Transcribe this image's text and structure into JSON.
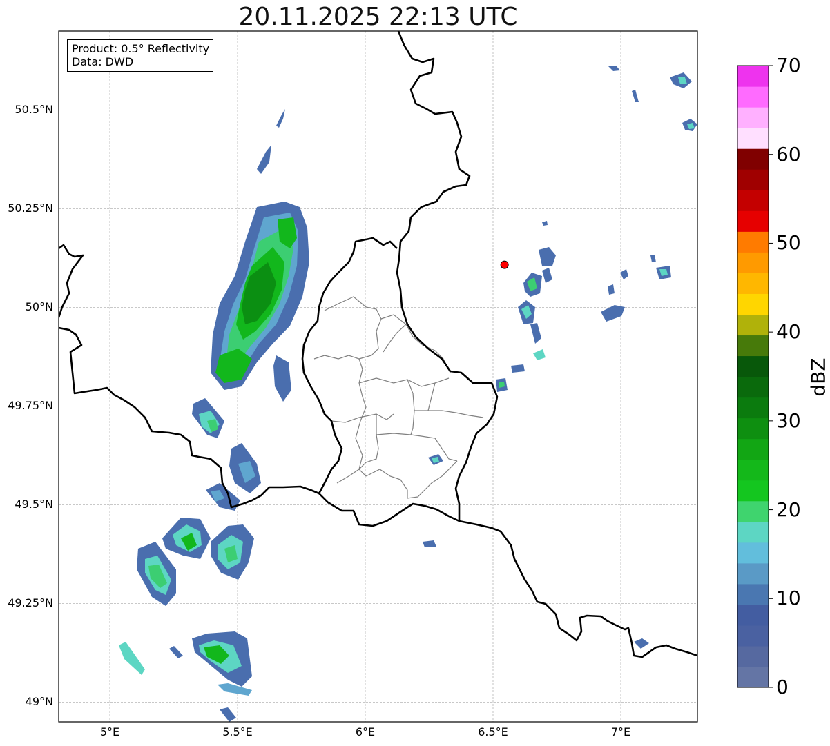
{
  "title": "20.11.2025 22:13 UTC",
  "info": {
    "product_line": "Product: 0.5° Reflectivity",
    "data_line": "Data: DWD"
  },
  "map": {
    "lon_range": [
      4.8,
      7.3
    ],
    "lat_range": [
      48.95,
      50.7
    ],
    "lat_ticks": [
      {
        "value": 49.0,
        "label": "49°N"
      },
      {
        "value": 49.25,
        "label": "49.25°N"
      },
      {
        "value": 49.5,
        "label": "49.5°N"
      },
      {
        "value": 49.75,
        "label": "49.75°N"
      },
      {
        "value": 50.0,
        "label": "50°N"
      },
      {
        "value": 50.25,
        "label": "50.25°N"
      },
      {
        "value": 50.5,
        "label": "50.5°N"
      }
    ],
    "lon_ticks": [
      {
        "value": 5.0,
        "label": "5°E"
      },
      {
        "value": 5.5,
        "label": "5.5°E"
      },
      {
        "value": 6.0,
        "label": "6°E"
      },
      {
        "value": 6.5,
        "label": "6.5°E"
      },
      {
        "value": 7.0,
        "label": "7°E"
      }
    ],
    "grid": true,
    "marker": {
      "lon": 6.545,
      "lat": 50.108,
      "color": "#ff0000"
    },
    "layers": [
      "national borders",
      "province/district boundaries",
      "radar reflectivity echoes",
      "radar site marker"
    ]
  },
  "colorbar": {
    "label": "dBZ",
    "min": 0,
    "max": 70,
    "ticks": [
      "0",
      "10",
      "20",
      "30",
      "40",
      "50",
      "60",
      "70"
    ],
    "colors": [
      "#6475a5",
      "#5669a0",
      "#4a61a1",
      "#435da1",
      "#4a77b1",
      "#5a9ac6",
      "#62bedc",
      "#5dd6c3",
      "#3fd46e",
      "#14c61f",
      "#14b81a",
      "#12a614",
      "#0e8f10",
      "#0b7b0e",
      "#0a6a0c",
      "#08580a",
      "#477a0a",
      "#b0b20a",
      "#ffd600",
      "#ffb700",
      "#ff9a00",
      "#ff7b00",
      "#e60000",
      "#c40000",
      "#a00000",
      "#800000",
      "#ffdfff",
      "#ffb0ff",
      "#ff6bff",
      "#ee33ee"
    ]
  }
}
